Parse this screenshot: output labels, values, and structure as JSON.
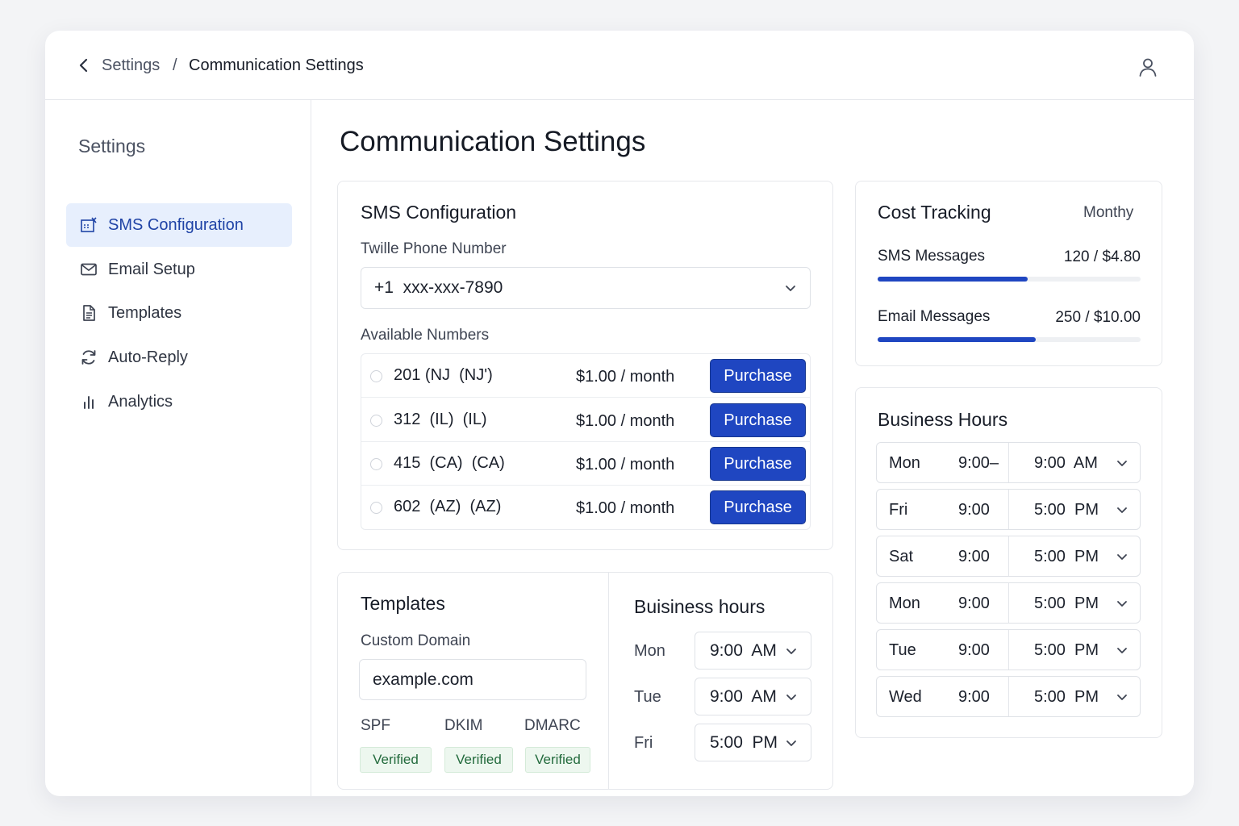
{
  "breadcrumb": {
    "root": "Settings",
    "separator": "/",
    "current": "Communication Settings"
  },
  "sidebar": {
    "title": "Settings",
    "items": [
      {
        "label": "SMS Configuration",
        "icon": "sms-config-icon",
        "active": true
      },
      {
        "label": "Email Setup",
        "icon": "mail-icon"
      },
      {
        "label": "Templates",
        "icon": "document-icon"
      },
      {
        "label": "Auto-Reply",
        "icon": "refresh-icon"
      },
      {
        "label": "Analytics",
        "icon": "bar-chart-icon"
      }
    ]
  },
  "page": {
    "title": "Communication Settings"
  },
  "sms": {
    "title": "SMS Configuration",
    "phone_label": "Twille Phone Number",
    "phone_value": "+1  xxx-xxx-7890",
    "available_label": "Available Numbers",
    "numbers": [
      {
        "code": "201 (NJ  (NJ')",
        "price": "$1.00 / month",
        "button": "Purchase"
      },
      {
        "code": "312  (IL)  (IL)",
        "price": "$1.00 / month",
        "button": "Purchase"
      },
      {
        "code": "415  (CA)  (CA)",
        "price": "$1.00 / month",
        "button": "Purchase"
      },
      {
        "code": "602  (AZ)  (AZ)",
        "price": "$1.00 / month",
        "button": "Purchase"
      }
    ]
  },
  "templates": {
    "title": "Templates",
    "domain_label": "Custom Domain",
    "domain_value": "example.com",
    "records": [
      {
        "name": "SPF",
        "status": "Verified"
      },
      {
        "name": "DKIM",
        "status": "Verified"
      },
      {
        "name": "DMARC",
        "status": "Verified"
      }
    ]
  },
  "business_hours_small": {
    "title": "Buisiness hours",
    "rows": [
      {
        "day": "Mon",
        "time": "9:00  AM"
      },
      {
        "day": "Tue",
        "time": "9:00  AM"
      },
      {
        "day": "Fri",
        "time": "5:00  PM"
      }
    ]
  },
  "cost": {
    "title": "Cost Tracking",
    "period": "Monthy",
    "items": [
      {
        "label": "SMS Messages",
        "value": "120 / $4.80",
        "progress": 0.57
      },
      {
        "label": "Email Messages",
        "value": "250 / $10.00",
        "progress": 0.6
      }
    ],
    "accent": "#1f46c1"
  },
  "business_hours": {
    "title": "Business Hours",
    "rows": [
      {
        "day": "Mon",
        "open": "9:00–",
        "close": "9:00  AM"
      },
      {
        "day": "Fri",
        "open": "9:00",
        "close": "5:00  PM"
      },
      {
        "day": "Sat",
        "open": "9:00",
        "close": "5:00  PM"
      },
      {
        "day": "Mon",
        "open": "9:00",
        "close": "5:00  PM"
      },
      {
        "day": "Tue",
        "open": "9:00",
        "close": "5:00  PM"
      },
      {
        "day": "Wed",
        "open": "9:00",
        "close": "5:00  PM"
      }
    ]
  }
}
